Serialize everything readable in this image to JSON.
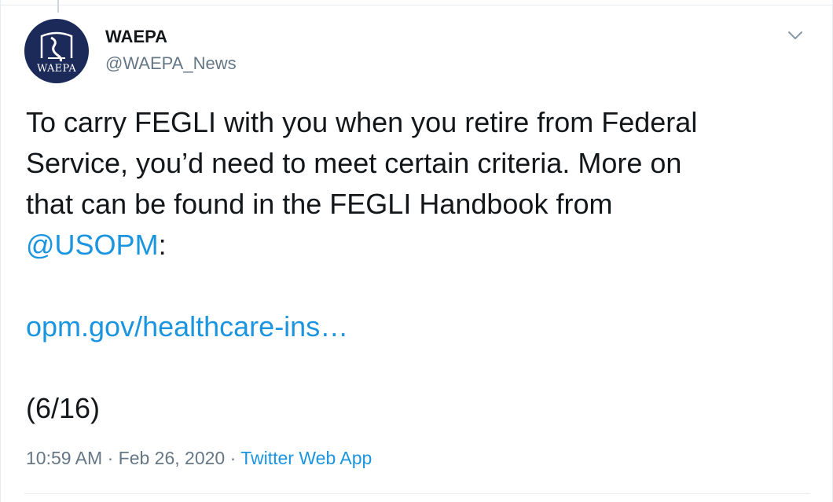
{
  "tweet": {
    "author": {
      "name": "WAEPA",
      "handle": "@WAEPA_News",
      "avatar_text": "WAEPA"
    },
    "text": {
      "line1": "To carry FEGLI with you when you retire from Federal",
      "line2": "Service, you’d need to meet certain criteria. More on",
      "line3": "that can be found in the FEGLI Handbook from",
      "mention": "@USOPM",
      "mention_suffix": ":",
      "url": "opm.gov/healthcare-ins…",
      "counter": "(6/16)"
    },
    "meta": {
      "time": "10:59 AM",
      "separator1": " · ",
      "date": "Feb 26, 2020",
      "separator2": " · ",
      "source": "Twitter Web App"
    },
    "menu_icon": "chevron-down-icon"
  },
  "colors": {
    "link": "#1b95e0",
    "secondary_text": "#657786",
    "text": "#14171a",
    "avatar_bg": "#1c2a5a",
    "border": "#e6ecf0"
  }
}
